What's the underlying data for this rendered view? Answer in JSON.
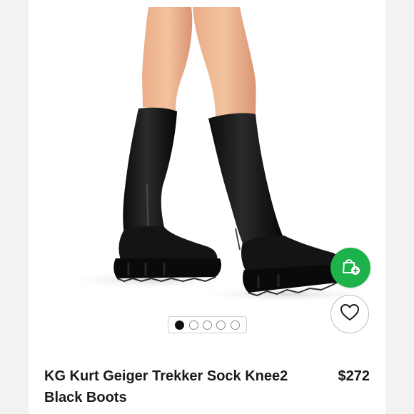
{
  "listing": {
    "title": "KG Kurt Geiger Trekker Sock Knee2 Black Boots",
    "price": "$272"
  },
  "carousel": {
    "total_images": 5,
    "active_index": 0
  },
  "actions": {
    "bag_icon": "shopping-bag-plus-icon",
    "like_icon": "heart-outline-icon"
  },
  "colors": {
    "accent_green": "#1db34a",
    "text": "#1a1a1a"
  }
}
